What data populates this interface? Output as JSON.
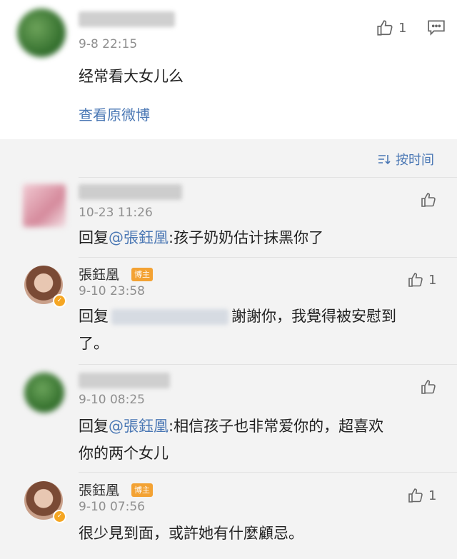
{
  "top_comment": {
    "time": "9-8 22:15",
    "text": "经常看大女儿么",
    "view_original": "查看原微博",
    "like_count": "1"
  },
  "sort_label": "按时间",
  "replies": [
    {
      "time": "10-23 11:26",
      "prefix": "回复",
      "mention": "@張鈺凰",
      "text": ":孩子奶奶估计抹黑你了"
    },
    {
      "name": "張鈺凰",
      "badge": "博主",
      "time": "9-10 23:58",
      "like_count": "1",
      "prefix": "回复",
      "text_line1": "謝謝你，我覺得被安慰到",
      "text_line2": "了。"
    },
    {
      "time": "9-10 08:25",
      "prefix": "回复",
      "mention": "@張鈺凰",
      "text_line1": ":相信孩子也非常爱你的，超喜欢",
      "text_line2": "你的两个女儿"
    },
    {
      "name": "張鈺凰",
      "badge": "博主",
      "time": "9-10 07:56",
      "like_count": "1",
      "text": "很少見到面，或許她有什麼顧忌。"
    }
  ]
}
